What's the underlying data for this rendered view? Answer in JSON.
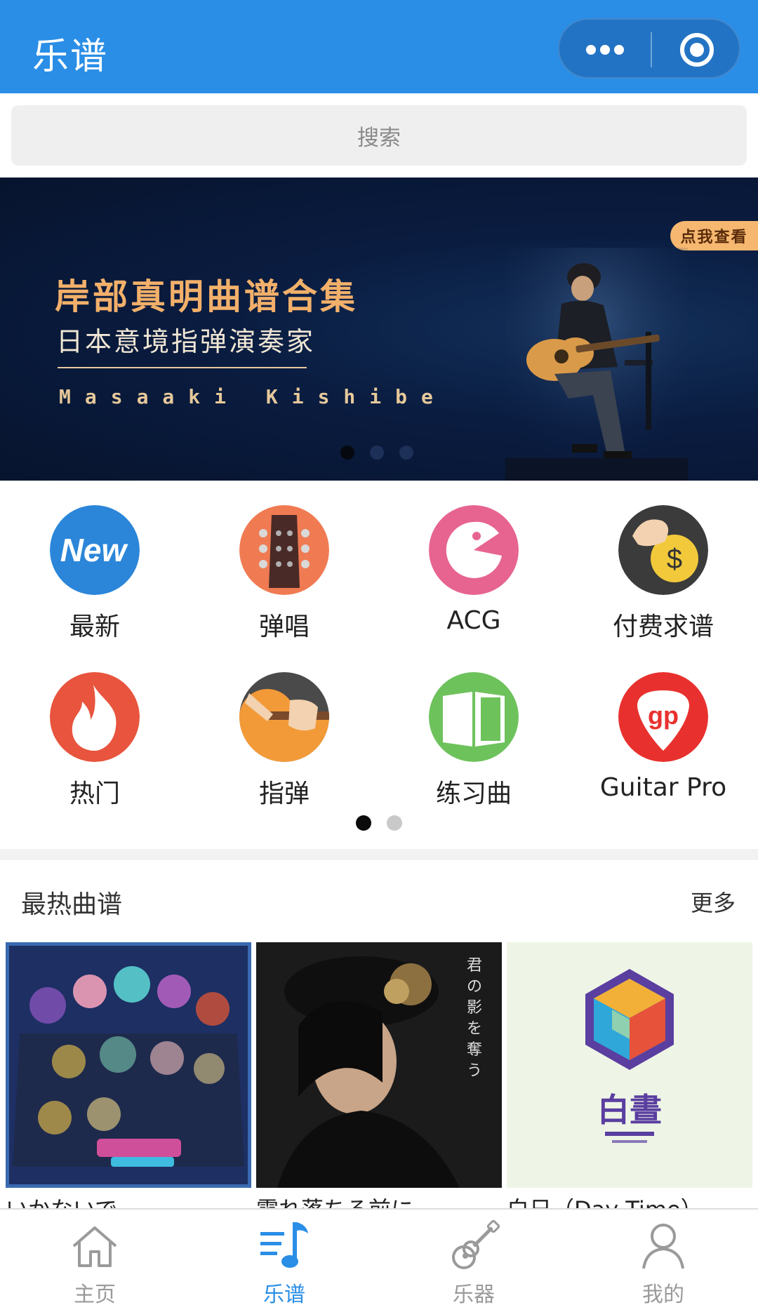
{
  "header": {
    "title": "乐谱",
    "more_icon": "more-dots-icon",
    "target_icon": "record-target-icon"
  },
  "search": {
    "placeholder": "搜索"
  },
  "banner": {
    "title": "岸部真明曲谱合集",
    "subtitle": "日本意境指弹演奏家",
    "name_en": "Masaaki Kishibe",
    "tag": "点我查看",
    "dots": 3,
    "active_dot": 0
  },
  "categories": [
    {
      "label": "最新",
      "icon": "new-icon",
      "color": "#2b86d9"
    },
    {
      "label": "弹唱",
      "icon": "guitar-headstock-icon",
      "color": "#f07b52"
    },
    {
      "label": "ACG",
      "icon": "pacman-icon",
      "color": "#e76490"
    },
    {
      "label": "付费求谱",
      "icon": "coin-dollar-icon",
      "color": "#3b3b3b"
    },
    {
      "label": "热门",
      "icon": "flame-icon",
      "color": "#e8543d"
    },
    {
      "label": "指弹",
      "icon": "fingerpick-icon",
      "color": "#f39a38"
    },
    {
      "label": "练习曲",
      "icon": "book-icon",
      "color": "#6ec25c"
    },
    {
      "label": "Guitar Pro",
      "icon": "gp-pick-icon",
      "color": "#e8312e"
    }
  ],
  "category_pages": {
    "count": 2,
    "active": 0
  },
  "hot": {
    "title": "最热曲谱",
    "more": "更多",
    "items": [
      {
        "name": "いかないで"
      },
      {
        "name": "零れ落ちる前に"
      },
      {
        "name": "白日（Day Time）"
      }
    ]
  },
  "tabs": [
    {
      "label": "主页",
      "icon": "home-icon",
      "active": false
    },
    {
      "label": "乐谱",
      "icon": "music-score-icon",
      "active": true
    },
    {
      "label": "乐器",
      "icon": "guitar-icon",
      "active": false
    },
    {
      "label": "我的",
      "icon": "user-icon",
      "active": false
    }
  ],
  "colors": {
    "primary": "#2a8ee6",
    "banner_text": "#f2b06a",
    "inactive_tab": "#9a9a9a"
  }
}
